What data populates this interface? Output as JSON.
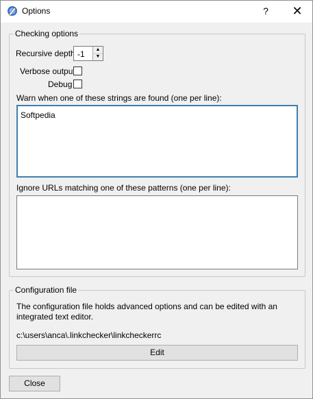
{
  "window": {
    "title": "Options",
    "help_label": "?",
    "close_label": "✕"
  },
  "checking": {
    "legend": "Checking options",
    "recursive_depth_label": "Recursive depth",
    "recursive_depth_value": "-1",
    "verbose_label": "Verbose output",
    "verbose_checked": false,
    "debug_label": "Debug",
    "debug_checked": false,
    "warn_label": "Warn when one of these strings are found (one per line):",
    "warn_value": "Softpedia",
    "ignore_label": "Ignore URLs matching one of these patterns (one per line):",
    "ignore_value": ""
  },
  "config": {
    "legend": "Configuration file",
    "description": "The configuration file holds advanced options and can be edited with an integrated text editor.",
    "path": "c:\\users\\anca\\.linkchecker\\linkcheckerrc",
    "edit_label": "Edit"
  },
  "footer": {
    "close_label": "Close"
  },
  "colors": {
    "focus_border": "#3c7fb1",
    "button_bg": "#e1e1e1"
  }
}
